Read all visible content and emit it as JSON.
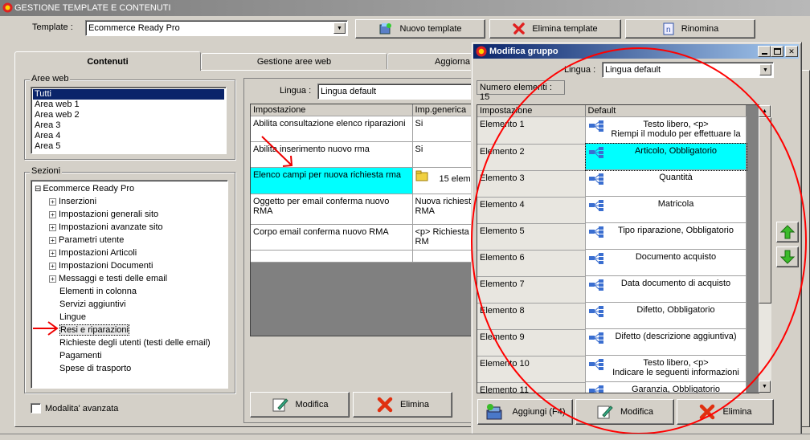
{
  "window": {
    "title": "GESTIONE TEMPLATE E CONTENUTI"
  },
  "template_bar": {
    "label": "Template :",
    "value": "Ecommerce Ready Pro",
    "new_button": "Nuovo template",
    "delete_button": "Elimina template",
    "rename_button": "Rinomina"
  },
  "tabs": [
    "Contenuti",
    "Gestione aree web",
    "Aggiorna"
  ],
  "aree_web": {
    "label": "Aree web",
    "items": [
      "Tutti",
      "Area web 1",
      "Area web 2",
      "Area 3",
      "Area 4",
      "Area 5"
    ],
    "selected": 0
  },
  "sezioni": {
    "label": "Sezioni",
    "root": "Ecommerce Ready Pro",
    "items": [
      {
        "label": "Inserzioni",
        "expandable": true
      },
      {
        "label": "Impostazioni generali sito",
        "expandable": true
      },
      {
        "label": "Impostazioni avanzate sito",
        "expandable": true
      },
      {
        "label": "Parametri utente",
        "expandable": true
      },
      {
        "label": "Impostazioni Articoli",
        "expandable": true
      },
      {
        "label": "Impostazioni Documenti",
        "expandable": true
      },
      {
        "label": "Messaggi e testi delle email",
        "expandable": true
      },
      {
        "label": "Elementi in colonna",
        "expandable": false
      },
      {
        "label": "Servizi aggiuntivi",
        "expandable": false
      },
      {
        "label": "Lingue",
        "expandable": false
      },
      {
        "label": "Resi e riparazioni",
        "expandable": false
      },
      {
        "label": "Richieste degli utenti (testi delle email)",
        "expandable": false
      },
      {
        "label": "Pagamenti",
        "expandable": false
      },
      {
        "label": "Spese di trasporto",
        "expandable": false
      }
    ],
    "selected_index": 10
  },
  "advanced_checkbox": "Modalita' avanzata",
  "main_panel": {
    "lingua_label": "Lingua :",
    "lingua_value": "Lingua default",
    "columns": [
      "Impostazione",
      "Imp.generica"
    ],
    "rows": [
      {
        "name": "Abilita consultazione elenco riparazioni",
        "value": "Si"
      },
      {
        "name": "Abilita inserimento nuovo rma",
        "value": "Si"
      },
      {
        "name": "Elenco campi per nuova richiesta rma",
        "value": "15 elem"
      },
      {
        "name": "Oggetto per email conferma nuovo RMA",
        "value": "Nuova richiest RMA"
      },
      {
        "name": "Corpo email conferma nuovo RMA",
        "value": "<p> Richiesta RM"
      }
    ],
    "modify_button": "Modifica",
    "delete_button": "Elimina"
  },
  "popup": {
    "title": "Modifica gruppo",
    "lingua_label": "Lingua :",
    "lingua_value": "Lingua default",
    "count_label": "Numero elementi : 15",
    "columns": [
      "Impostazione",
      "Default"
    ],
    "rows": [
      {
        "name": "Elemento 1",
        "line1": "Testo libero, <p>",
        "line2": "Riempi il modulo per effettuare la"
      },
      {
        "name": "Elemento 2",
        "line1": "Articolo, Obbligatorio",
        "line2": ""
      },
      {
        "name": "Elemento 3",
        "line1": "Quantità",
        "line2": ""
      },
      {
        "name": "Elemento 4",
        "line1": "Matricola",
        "line2": ""
      },
      {
        "name": "Elemento 5",
        "line1": "Tipo riparazione, Obbligatorio",
        "line2": ""
      },
      {
        "name": "Elemento 6",
        "line1": "Documento acquisto",
        "line2": ""
      },
      {
        "name": "Elemento 7",
        "line1": "Data documento di acquisto",
        "line2": ""
      },
      {
        "name": "Elemento 8",
        "line1": "Difetto, Obbligatorio",
        "line2": ""
      },
      {
        "name": "Elemento 9",
        "line1": "Difetto (descrizione aggiuntiva)",
        "line2": ""
      },
      {
        "name": "Elemento 10",
        "line1": "Testo libero, <p>",
        "line2": "Indicare le seguenti informazioni"
      },
      {
        "name": "Elemento 11",
        "line1": "Garanzia, Obbligatorio",
        "line2": ""
      }
    ],
    "selected_row": 1,
    "add_button": "Aggiungi (F4)",
    "modify_button": "Modifica",
    "delete_button": "Elimina"
  },
  "colors": {
    "highlight_cyan": "#00ffff",
    "selection_navy": "#0a246a",
    "annotation_red": "#ff0000"
  }
}
